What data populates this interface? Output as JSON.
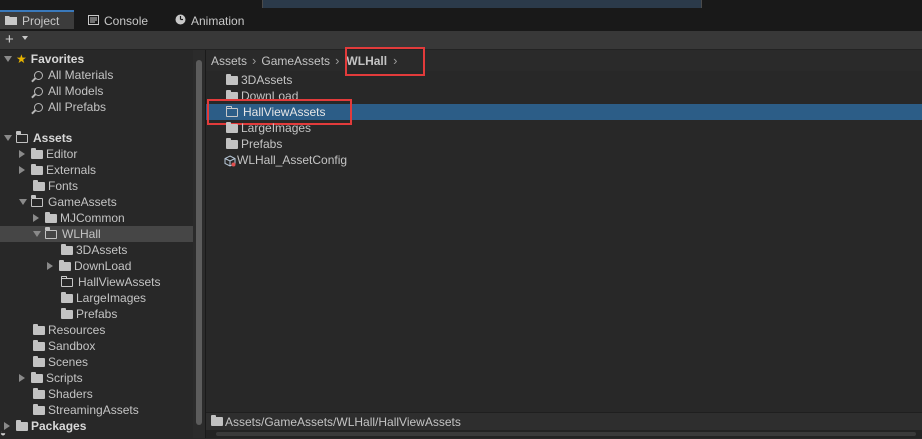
{
  "tabs": [
    {
      "label": "Project",
      "icon": "folder-icon",
      "active": true
    },
    {
      "label": "Console",
      "icon": "console-icon",
      "active": false
    },
    {
      "label": "Animation",
      "icon": "animation-clock-icon",
      "active": false
    }
  ],
  "toolbar": {
    "add_label": "+"
  },
  "tree": {
    "favorites": {
      "label": "Favorites",
      "items": [
        "All Materials",
        "All Models",
        "All Prefabs"
      ]
    },
    "assets": {
      "label": "Assets",
      "items": [
        {
          "label": "Editor"
        },
        {
          "label": "Externals"
        },
        {
          "label": "Fonts"
        },
        {
          "label": "GameAssets"
        },
        {
          "label": "MJCommon"
        },
        {
          "label": "WLHall"
        },
        {
          "label": "3DAssets"
        },
        {
          "label": "DownLoad"
        },
        {
          "label": "HallViewAssets"
        },
        {
          "label": "LargeImages"
        },
        {
          "label": "Prefabs"
        },
        {
          "label": "Resources"
        },
        {
          "label": "Sandbox"
        },
        {
          "label": "Scenes"
        },
        {
          "label": "Scripts"
        },
        {
          "label": "Shaders"
        },
        {
          "label": "StreamingAssets"
        }
      ]
    },
    "packages": {
      "label": "Packages"
    }
  },
  "breadcrumb": {
    "items": [
      "Assets",
      "GameAssets",
      "WLHall"
    ]
  },
  "files": [
    {
      "label": "3DAssets",
      "type": "folder"
    },
    {
      "label": "DownLoad",
      "type": "folder"
    },
    {
      "label": "HallViewAssets",
      "type": "folder",
      "selected": true
    },
    {
      "label": "LargeImages",
      "type": "folder"
    },
    {
      "label": "Prefabs",
      "type": "folder"
    },
    {
      "label": "WLHall_AssetConfig",
      "type": "asset"
    }
  ],
  "status": {
    "path": "Assets/GameAssets/WLHall/HallViewAssets"
  },
  "colors": {
    "selection": "#2c5d87",
    "highlight_box": "#e23b3b",
    "star": "#e8b400"
  }
}
